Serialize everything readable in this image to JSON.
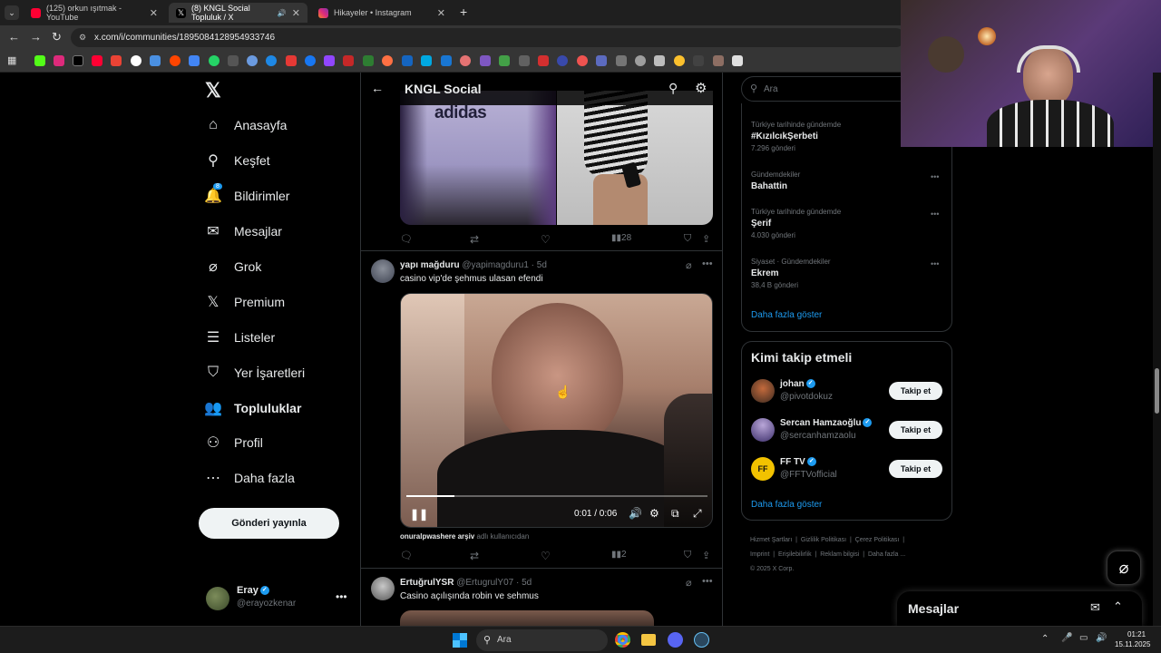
{
  "browser": {
    "tabs": [
      {
        "label": "(125) orkun ışıtmak - YouTube",
        "color": "#ff0033"
      },
      {
        "label": "(8) KNGL Social Topluluk / X",
        "color": "#ffffff"
      },
      {
        "label": "Hikayeler • Instagram",
        "color": "#e1306c"
      }
    ],
    "url": "x.com/i/communities/1895084128954933746"
  },
  "nav": {
    "items": [
      {
        "label": "Anasayfa",
        "icon": "home-icon"
      },
      {
        "label": "Keşfet",
        "icon": "search-icon"
      },
      {
        "label": "Bildirimler",
        "icon": "bell-icon",
        "badge": "8"
      },
      {
        "label": "Mesajlar",
        "icon": "mail-icon"
      },
      {
        "label": "Grok",
        "icon": "grok-icon"
      },
      {
        "label": "Premium",
        "icon": "x-logo-icon"
      },
      {
        "label": "Listeler",
        "icon": "list-icon"
      },
      {
        "label": "Yer İşaretleri",
        "icon": "bookmark-icon"
      },
      {
        "label": "Topluluklar",
        "icon": "communities-icon"
      },
      {
        "label": "Profil",
        "icon": "person-icon"
      },
      {
        "label": "Daha fazla",
        "icon": "more-circle-icon"
      }
    ],
    "post_button": "Gönderi yayınla",
    "account": {
      "name": "Eray",
      "handle": "@erayozkenar"
    }
  },
  "header": {
    "title": "KNGL Social"
  },
  "tweets": [
    {
      "image_text": "adidas",
      "views": "28"
    },
    {
      "author": "yapı mağduru",
      "handle": "@yapimagduru1",
      "time": "· 5d",
      "text": "casino vip'de şehmus ulasan efendi",
      "video_time": "0:01 / 0:06",
      "video_progress": 0.16,
      "source_user": "onuralpwashere arşiv",
      "source_suffix": "adlı kullanıcıdan",
      "views": "2"
    },
    {
      "author": "ErtuğrulYSR",
      "handle": "@ErtugrulY07",
      "time": "· 5d",
      "text": "Casino açılışında robin ve sehmus"
    }
  ],
  "right": {
    "search_placeholder": "Ara",
    "trends": [
      {
        "meta": "Türkiye tarihinde gündemde",
        "name": "#KızılcıkŞerbeti",
        "count": "7.296 gönderi"
      },
      {
        "meta": "Gündemdekiler",
        "name": "Bahattin",
        "count": ""
      },
      {
        "meta": "Türkiye tarihinde gündemde",
        "name": "Şerif",
        "count": "4.030 gönderi"
      },
      {
        "meta": "Siyaset · Gündemdekiler",
        "name": "Ekrem",
        "count": "38,4 B gönderi"
      }
    ],
    "trends_more": "Daha fazla göster",
    "who_to_follow_title": "Kimi takip etmeli",
    "follow": [
      {
        "name": "johan",
        "handle": "@pivotdokuz",
        "button": "Takip et"
      },
      {
        "name": "Sercan Hamzaoğlu",
        "handle": "@sercanhamzaolu",
        "button": "Takip et"
      },
      {
        "name": "FF TV",
        "handle": "@FFTVofficial",
        "button": "Takip et"
      }
    ],
    "follow_more": "Daha fazla göster",
    "footer": [
      "Hizmet Şartları",
      "Gizlilik Politikası",
      "Çerez Politikası",
      "Imprint",
      "Erişilebilirlik",
      "Reklam bilgisi",
      "Daha fazla ..."
    ],
    "copyright": "© 2025 X Corp."
  },
  "messages_drawer": {
    "title": "Mesajlar"
  },
  "taskbar": {
    "search": "Ara",
    "time": "01:21",
    "date": "15.11.2025"
  }
}
